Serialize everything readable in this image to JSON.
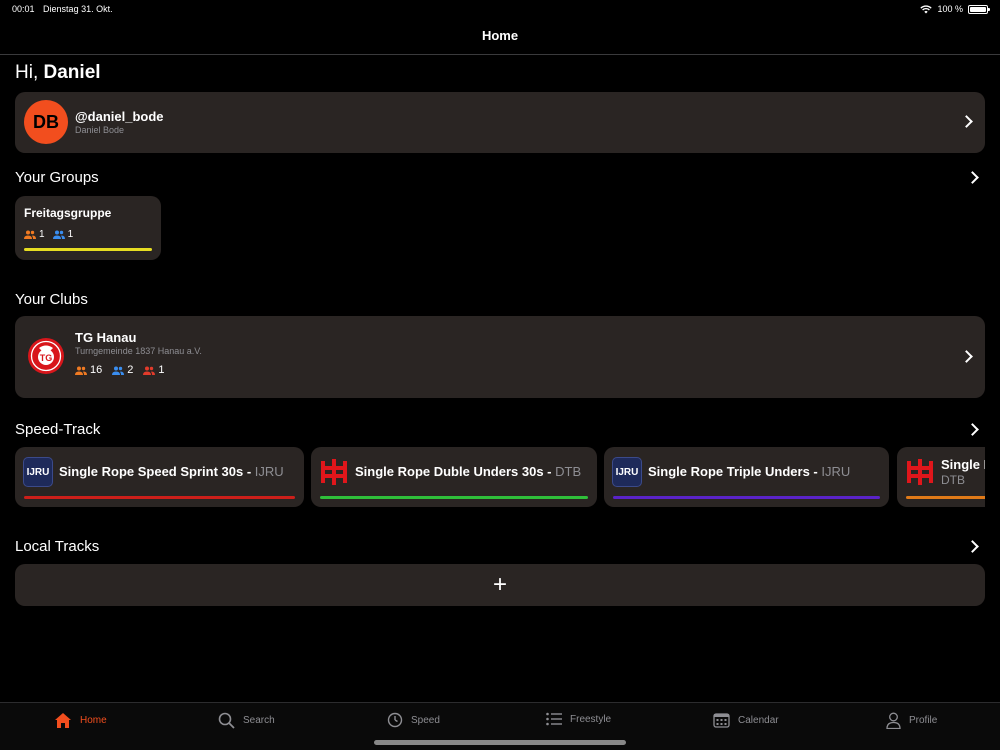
{
  "status": {
    "time": "00:01",
    "date": "Dienstag 31. Okt.",
    "battery": "100 %"
  },
  "nav": {
    "title": "Home"
  },
  "greeting": {
    "prefix": "Hi,",
    "name": "Daniel"
  },
  "profile": {
    "initials": "DB",
    "handle": "@daniel_bode",
    "name": "Daniel Bode"
  },
  "groups": {
    "title": "Your Groups",
    "items": [
      {
        "name": "Freitagsgruppe",
        "athletes": "1",
        "coaches": "1",
        "color": "#e6dd22"
      }
    ]
  },
  "clubs": {
    "title": "Your Clubs",
    "items": [
      {
        "name": "TG Hanau",
        "full_name": "Turngemeinde 1837 Hanau a.V.",
        "athletes": "16",
        "coaches": "2",
        "admins": "1"
      }
    ]
  },
  "speed_track": {
    "title": "Speed-Track",
    "items": [
      {
        "title": "Single Rope Speed Sprint 30s - ",
        "org": "IJRU",
        "logo": "IJRU",
        "color": "#cc1f1a"
      },
      {
        "title": "Single Rope Duble Unders 30s - ",
        "org": "DTB",
        "logo": "DTB",
        "color": "#2fbf3a"
      },
      {
        "title": "Single Rope Triple Unders - ",
        "org": "IJRU",
        "logo": "IJRU",
        "color": "#5a23c8"
      },
      {
        "title": "Single Rope",
        "org": "DTB",
        "logo": "DTB",
        "color": "#e07a18"
      }
    ]
  },
  "local_tracks": {
    "title": "Local Tracks",
    "add_label": "+"
  },
  "tabs": [
    {
      "label": "Home",
      "icon": "house-icon"
    },
    {
      "label": "Search",
      "icon": "magnifier-icon"
    },
    {
      "label": "Speed",
      "icon": "stopwatch-icon"
    },
    {
      "label": "Freestyle",
      "icon": "list-icon"
    },
    {
      "label": "Calendar",
      "icon": "calendar-icon"
    },
    {
      "label": "Profile",
      "icon": "person-icon"
    }
  ],
  "colors": {
    "accent": "#f24e1e",
    "card": "#2a2523",
    "athlete": "#f07a22",
    "coach": "#3a8ef0",
    "admin": "#e23b2b"
  }
}
